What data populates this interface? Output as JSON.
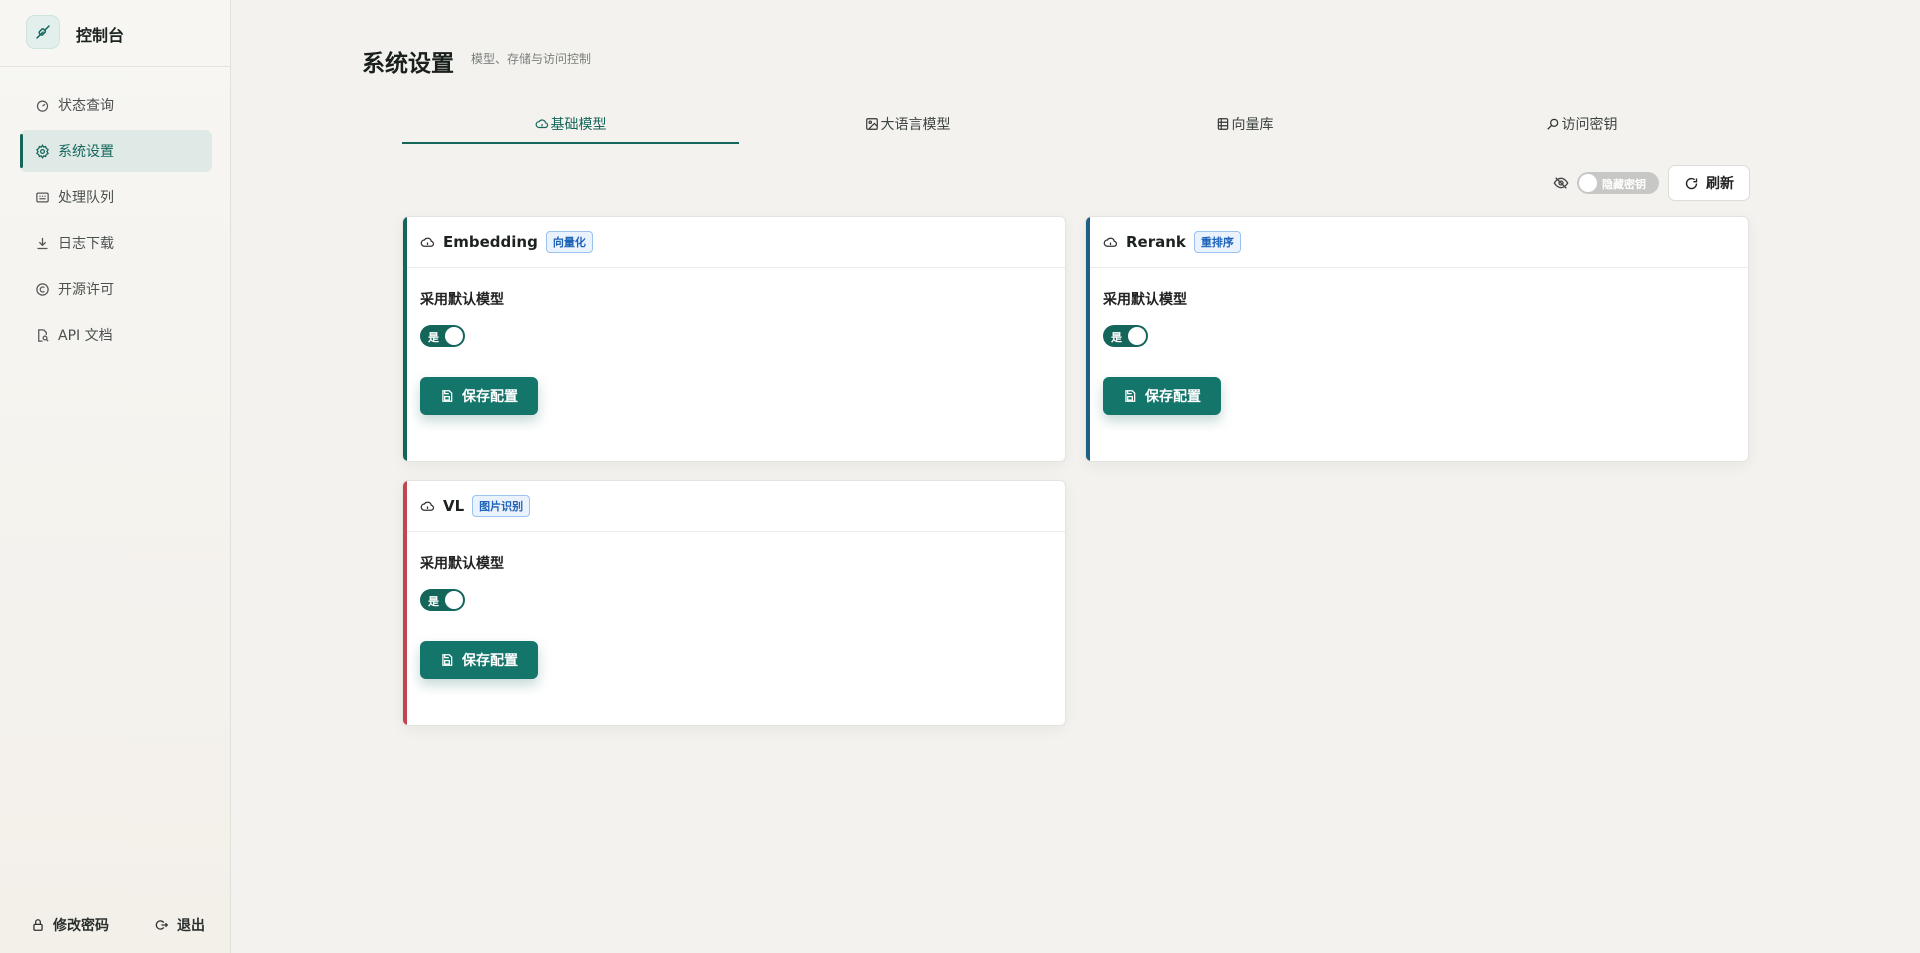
{
  "sidebar": {
    "brand_title": "控制台",
    "items": [
      {
        "label": "状态查询",
        "icon": "gauge-icon"
      },
      {
        "label": "系统设置",
        "icon": "gear-icon"
      },
      {
        "label": "处理队列",
        "icon": "queue-icon"
      },
      {
        "label": "日志下载",
        "icon": "download-icon"
      },
      {
        "label": "开源许可",
        "icon": "copyright-icon"
      },
      {
        "label": "API 文档",
        "icon": "doc-search-icon"
      }
    ],
    "active_index": 1,
    "footer": {
      "change_password": "修改密码",
      "logout": "退出"
    }
  },
  "header": {
    "title": "系统设置",
    "subtitle": "模型、存储与访问控制"
  },
  "tabs": [
    {
      "label": "基础模型",
      "icon": "cloud-icon"
    },
    {
      "label": "大语言模型",
      "icon": "image-icon"
    },
    {
      "label": "向量库",
      "icon": "database-icon"
    },
    {
      "label": "访问密钥",
      "icon": "key-search-icon"
    }
  ],
  "toolbar": {
    "hide_keys_label": "隐藏密钥",
    "hide_keys_on": false,
    "refresh_label": "刷新"
  },
  "cards": [
    {
      "title": "Embedding",
      "badge": "向量化",
      "field_label": "采用默认模型",
      "switch_label": "是",
      "switch_on": true,
      "save_label": "保存配置",
      "accent": "#14665b"
    },
    {
      "title": "Rerank",
      "badge": "重排序",
      "field_label": "采用默认模型",
      "switch_label": "是",
      "switch_on": true,
      "save_label": "保存配置",
      "accent": "#1f5f85"
    },
    {
      "title": "VL",
      "badge": "图片识别",
      "field_label": "采用默认模型",
      "switch_label": "是",
      "switch_on": true,
      "save_label": "保存配置",
      "accent": "#c2464e"
    }
  ],
  "colors": {
    "primary": "#14665b",
    "badge_blue": "#1f63b8"
  }
}
